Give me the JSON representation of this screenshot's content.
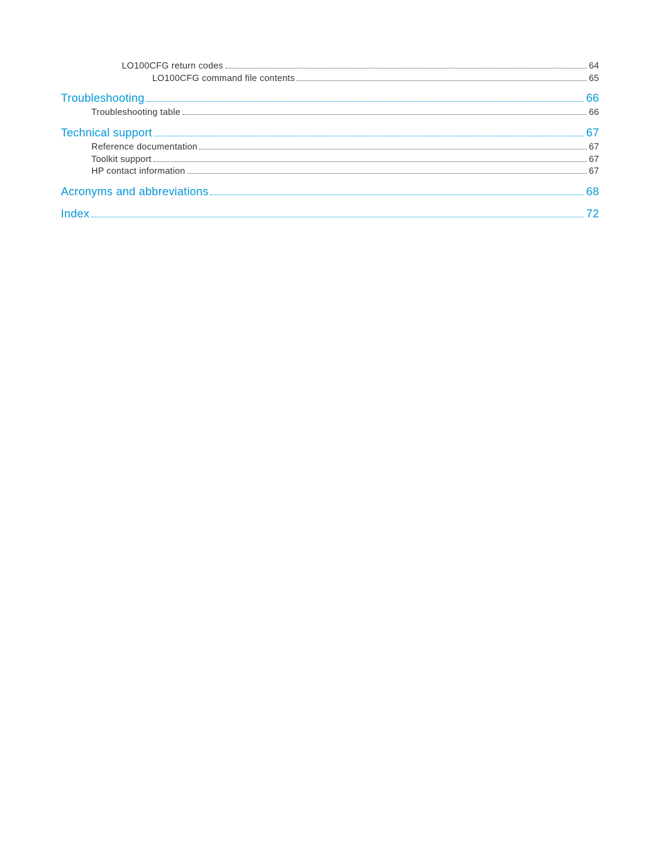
{
  "toc": {
    "entries": [
      {
        "level": 2,
        "label": "LO100CFG return codes",
        "page": "64",
        "link": false,
        "group_break": false
      },
      {
        "level": 3,
        "label": "LO100CFG command file contents",
        "page": "65",
        "link": false,
        "group_break": true
      },
      {
        "level": 0,
        "label": "Troubleshooting",
        "page": "66",
        "link": true,
        "group_break": false
      },
      {
        "level": 1,
        "label": "Troubleshooting table",
        "page": "66",
        "link": false,
        "group_break": true
      },
      {
        "level": 0,
        "label": "Technical support",
        "page": "67",
        "link": true,
        "group_break": false
      },
      {
        "level": 1,
        "label": "Reference documentation",
        "page": "67",
        "link": false,
        "group_break": false
      },
      {
        "level": 1,
        "label": "Toolkit support",
        "page": "67",
        "link": false,
        "group_break": false
      },
      {
        "level": 1,
        "label": "HP contact information",
        "page": "67",
        "link": false,
        "group_break": true
      },
      {
        "level": 0,
        "label": "Acronyms and abbreviations",
        "page": "68",
        "link": true,
        "group_break": true
      },
      {
        "level": 0,
        "label": "Index",
        "page": "72",
        "link": true,
        "group_break": true
      }
    ]
  }
}
